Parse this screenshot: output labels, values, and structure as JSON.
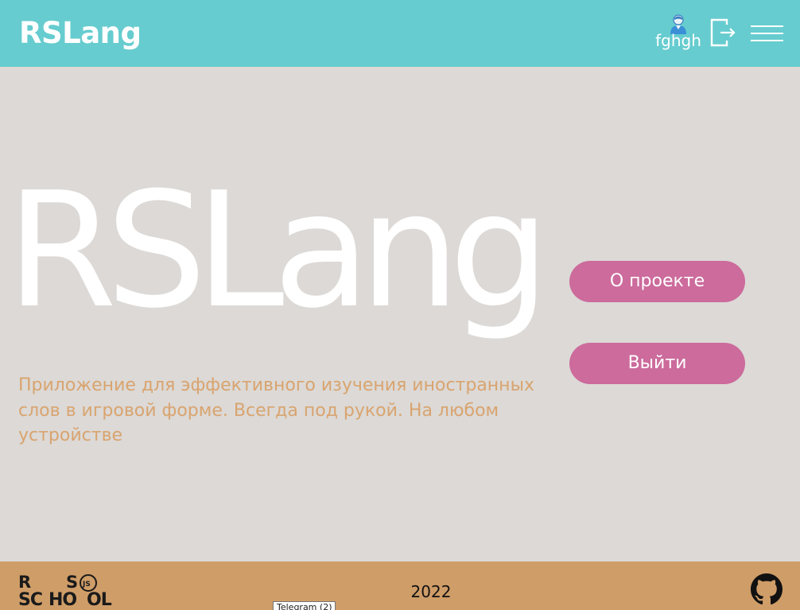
{
  "header": {
    "logo": "RSLang",
    "user_name": "fghgh",
    "user_icon": "user-avatar-icon",
    "logout_icon": "logout-icon",
    "menu_icon": "burger-menu-icon"
  },
  "hero": {
    "title": "RSLang",
    "description": "Приложение для эффективного изучения иностранных слов в игровой форме. Всегда под рукой. На любом устройстве"
  },
  "actions": {
    "about_label": "О проекте",
    "logout_label": "Выйти"
  },
  "footer": {
    "school_logo": "rs-school-logo",
    "year": "2022",
    "github_icon": "github-icon"
  },
  "tooltip": {
    "text": "Telegram (2)"
  },
  "colors": {
    "header_bg": "#66cccf",
    "page_bg": "#dcd9d6",
    "footer_bg": "#cf9d68",
    "button_bg": "#cc6b9c",
    "description_text": "#d9a46f"
  }
}
